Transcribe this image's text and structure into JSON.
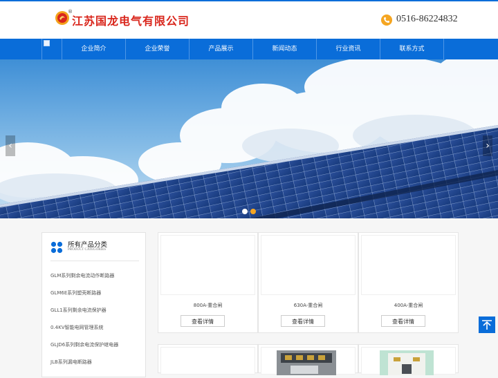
{
  "header": {
    "company_name": "江苏国龙电气有限公司",
    "registered_mark": "®",
    "phone": "0516-86224832"
  },
  "nav": {
    "items": [
      "企业简介",
      "企业荣誉",
      "产品展示",
      "新闻动态",
      "行业资讯",
      "联系方式"
    ]
  },
  "banner": {
    "prev_glyph": "‹",
    "next_glyph": "›",
    "active_dot": 2
  },
  "sidebar": {
    "title": "所有产品分类",
    "subtitle": "PRODUCT CATEGORIES",
    "items": [
      "GLM系列剩余电流动作断路器",
      "GLM6E系列塑壳断路器",
      "GLL1系列剩余电流保护器",
      "0.4KV智能电网管理系统",
      "GLJD6系列剩余电流保护继电器",
      "JLB系列漏电断路器"
    ]
  },
  "products": [
    {
      "name": "800A-重合闸",
      "button": "查看详情"
    },
    {
      "name": "630A-重合闸",
      "button": "查看详情"
    },
    {
      "name": "400A-重合闸",
      "button": "查看详情"
    }
  ],
  "colors": {
    "brand_blue": "#0a6dd9",
    "brand_red": "#d9261c",
    "phone_icon": "#f5a623"
  },
  "icons": {
    "back_to_top": "arrow-up-icon",
    "phone": "phone-icon",
    "categories": "grid-icon"
  }
}
